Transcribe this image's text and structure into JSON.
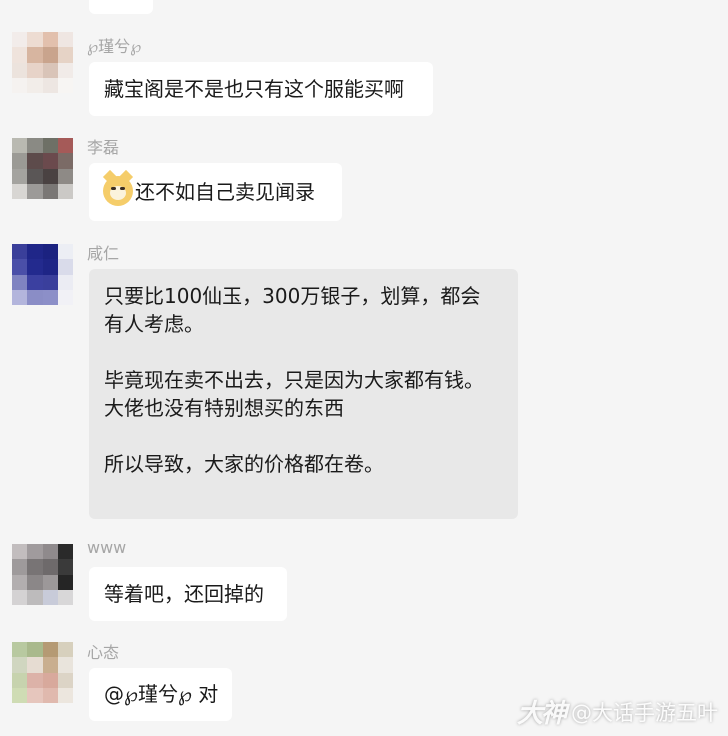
{
  "messages": [
    {
      "sender": "℘瑾兮℘",
      "text": "藏宝阁是不是也只有这个服能买啊",
      "avatar_colors": [
        "#f2ecea",
        "#eddcd2",
        "#e2c0ad",
        "#efe6e2",
        "#efe3dc",
        "#d7b5a0",
        "#c9a48d",
        "#e6d3c6",
        "#ece3dd",
        "#e7d3c8",
        "#d9c4b8",
        "#f1ebe8",
        "#f5f2f0",
        "#f2ede9",
        "#ede6e2",
        "#f7f5f3"
      ]
    },
    {
      "sender": "李磊",
      "emoji": "doge-emoji",
      "text": "还不如自己卖见闻录",
      "avatar_colors": [
        "#b9b9b1",
        "#8a8a84",
        "#6e7066",
        "#a55a58",
        "#9b9a95",
        "#5d4b4b",
        "#6b4a4d",
        "#7b6b66",
        "#a4a39f",
        "#5a5656",
        "#4a4242",
        "#8e8a86",
        "#d8d6d3",
        "#9c9a98",
        "#7a7775",
        "#cbc9c6"
      ]
    },
    {
      "sender": "咸仁",
      "paragraphs": [
        "只要比100仙玉，300万银子，划算，都会\n有人考虑。",
        "毕竟现在卖不出去，只是因为大家都有钱。\n大佬也没有特别想买的东西",
        "所以导致，大家的价格都在卷。"
      ],
      "avatar_colors": [
        "#3a3f9a",
        "#1f2688",
        "#1b2280",
        "#eceef4",
        "#4a4fa8",
        "#232a8e",
        "#1e2586",
        "#d9dbea",
        "#7f83c1",
        "#3b40a0",
        "#3a3f9c",
        "#ebecf3",
        "#b3b5dc",
        "#8a8dc6",
        "#8c8fc8",
        "#f1f1f6"
      ]
    },
    {
      "sender": "www",
      "text": "等着吧，还回掉的",
      "avatar_colors": [
        "#c2bdbe",
        "#a09b9d",
        "#8f8a8c",
        "#2a2a2a",
        "#9e9a9b",
        "#787475",
        "#6e6a6b",
        "#3a3a3a",
        "#b2aeaf",
        "#8b8788",
        "#9c9899",
        "#252525",
        "#d4d2d3",
        "#bdbbbc",
        "#c8cbd9",
        "#d8d7d8"
      ]
    },
    {
      "sender": "心态",
      "text": "@℘瑾兮℘ 对",
      "avatar_colors": [
        "#b8c9a0",
        "#a9b98c",
        "#b59a74",
        "#d7d0bd",
        "#d0d6c0",
        "#e6dcd2",
        "#c9ae8f",
        "#e9e4dc",
        "#c7d3ae",
        "#dcb2a8",
        "#d8a99c",
        "#dcd4c6",
        "#cfdcb4",
        "#e6c6bd",
        "#e0b9ae",
        "#ece6de"
      ]
    }
  ],
  "watermark": {
    "logo": "大神",
    "text": "@大话手游五叶"
  }
}
